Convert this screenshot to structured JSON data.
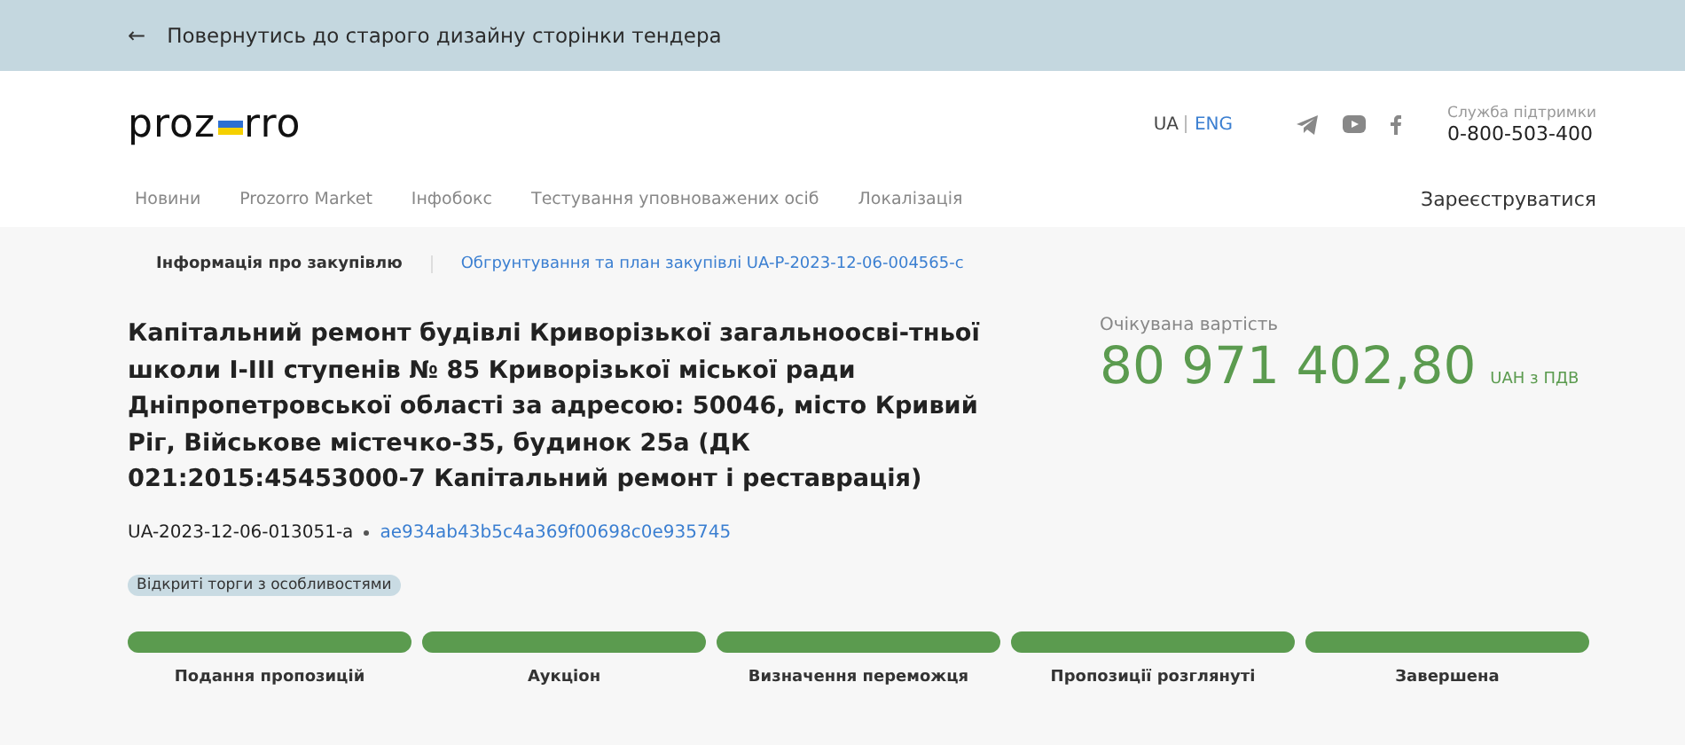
{
  "back_bar": {
    "arrow": "←",
    "label": "Повернутись до старого дизайну сторінки тендера"
  },
  "header": {
    "logo": {
      "left": "proz",
      "right": "rro"
    },
    "languages": [
      {
        "label": "UA",
        "selected": false
      },
      {
        "label": "ENG",
        "selected": true
      }
    ],
    "support": {
      "label": "Служба підтримки",
      "phone": "0-800-503-400"
    },
    "nav": [
      "Новини",
      "Prozorro Market",
      "Інфобокс",
      "Тестування уповноважених осіб",
      "Локалізація"
    ],
    "register": "Зареєструватися"
  },
  "tabs": [
    {
      "label": "Інформація про закупівлю",
      "selected": true
    },
    {
      "label": "Обгрунтування та план закупівлі UA-P-2023-12-06-004565-c",
      "selected": false
    }
  ],
  "tender": {
    "title": "Капітальний ремонт будівлі Криворізької загальноосві-тньої школи I-III ступенів № 85 Криворізької міської ради Дніпропетровської області за адресою: 50046, місто Кривий Ріг, Військове містечко-35, будинок 25а (ДК 021:2015:45453000-7 Капітальний ремонт і реставрація)",
    "id": "UA-2023-12-06-013051-a",
    "hash": "ae934ab43b5c4a369f00698c0e935745",
    "procedure": "Відкриті торги з особливостями"
  },
  "value": {
    "label": "Очікувана вартість",
    "amount": "80 971 402,80",
    "currency": "UAH з ПДВ"
  },
  "stages": [
    {
      "label": "Подання пропозицій",
      "done": true
    },
    {
      "label": "Аукціон",
      "done": true
    },
    {
      "label": "Визначення переможця",
      "done": true
    },
    {
      "label": "Пропозиції розглянуті",
      "done": true
    },
    {
      "label": "Завершена",
      "done": true
    }
  ]
}
